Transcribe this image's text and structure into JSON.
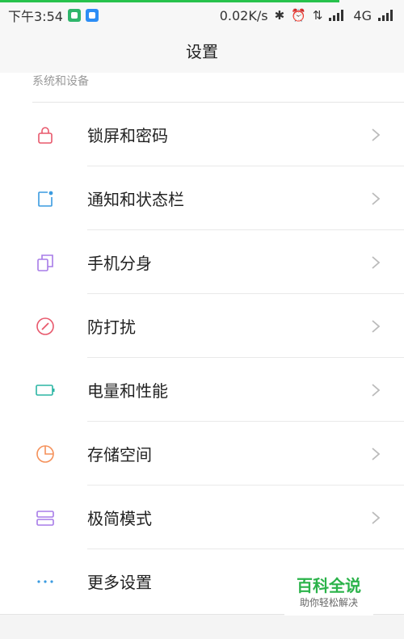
{
  "status_bar": {
    "time": "下午3:54",
    "net_speed": "0.02K/s",
    "network": "4G"
  },
  "header": {
    "title": "设置"
  },
  "section": {
    "title": "系统和设备"
  },
  "items": [
    {
      "label": "锁屏和密码",
      "icon": "lock-icon",
      "color": "#e8586c"
    },
    {
      "label": "通知和状态栏",
      "icon": "notification-icon",
      "color": "#3a9be0"
    },
    {
      "label": "手机分身",
      "icon": "second-space-icon",
      "color": "#a77be8"
    },
    {
      "label": "防打扰",
      "icon": "do-not-disturb-icon",
      "color": "#e8586c"
    },
    {
      "label": "电量和性能",
      "icon": "battery-icon",
      "color": "#2bb5a4"
    },
    {
      "label": "存储空间",
      "icon": "storage-icon",
      "color": "#f5915a"
    },
    {
      "label": "极简模式",
      "icon": "lite-mode-icon",
      "color": "#a77be8"
    },
    {
      "label": "更多设置",
      "icon": "more-icon",
      "color": "#3a9be0"
    }
  ],
  "watermark": {
    "title": "百科全说",
    "subtitle": "助你轻松解决"
  }
}
